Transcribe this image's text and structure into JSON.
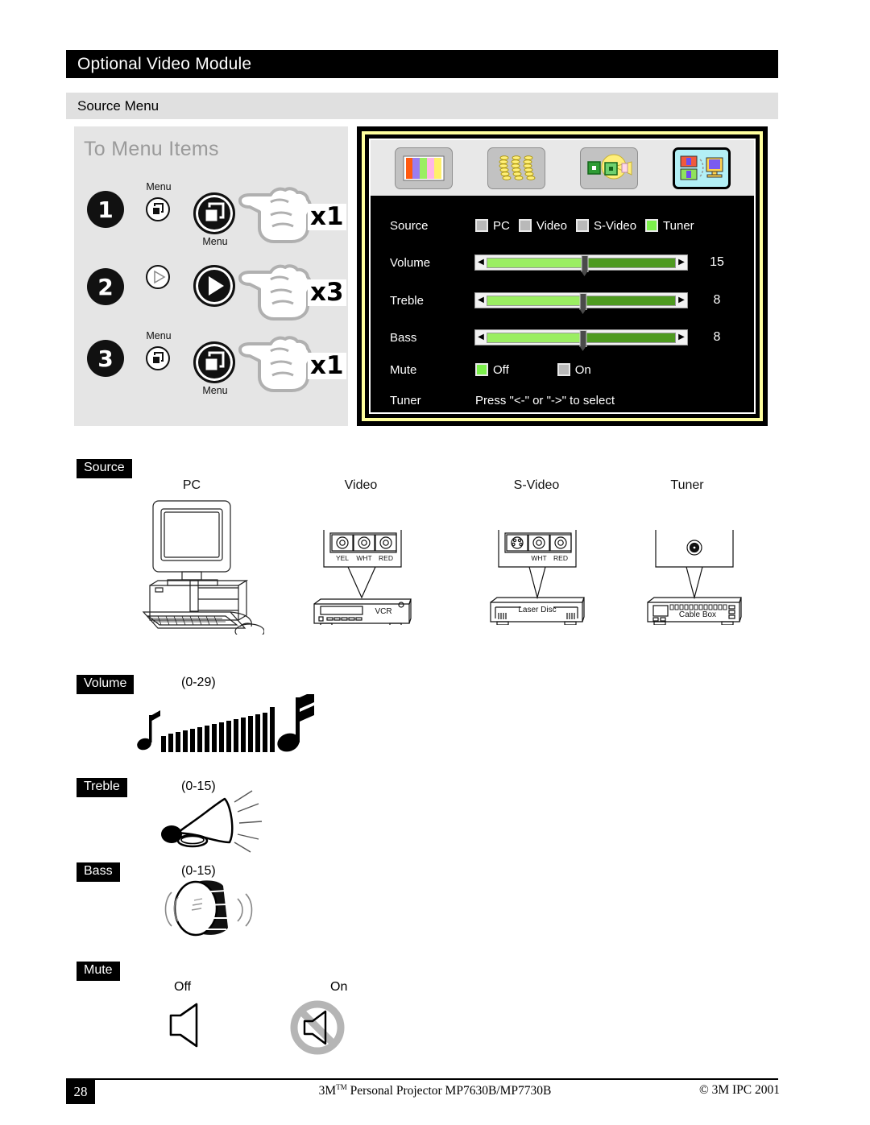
{
  "header": {
    "title": "Optional Video Module",
    "section": "Source Menu"
  },
  "steps_panel": {
    "title": "To Menu Items",
    "steps": [
      {
        "number": "1",
        "small_label": "Menu",
        "big_label": "Menu",
        "small_icon": "menu-icon",
        "big_icon": "menu-icon",
        "times": "x1"
      },
      {
        "number": "2",
        "small_label": "",
        "big_label": "",
        "small_icon": "play-right-arrow-icon",
        "big_icon": "play-right-arrow-icon",
        "times": "x3"
      },
      {
        "number": "3",
        "small_label": "Menu",
        "big_label": "Menu",
        "small_icon": "menu-icon",
        "big_icon": "menu-icon",
        "times": "x1"
      }
    ]
  },
  "osd": {
    "toolbar": [
      {
        "name": "color-bars-icon",
        "selected": false
      },
      {
        "name": "keystone-icon",
        "selected": false
      },
      {
        "name": "image-adjust-icon",
        "selected": false
      },
      {
        "name": "source-video-icon",
        "selected": true
      }
    ],
    "rows": {
      "source": {
        "label": "Source",
        "options": [
          {
            "label": "PC",
            "selected": false
          },
          {
            "label": "Video",
            "selected": false
          },
          {
            "label": "S-Video",
            "selected": false
          },
          {
            "label": "Tuner",
            "selected": true
          }
        ]
      },
      "volume": {
        "label": "Volume",
        "value": "15",
        "percent": 52
      },
      "treble": {
        "label": "Treble",
        "value": "8",
        "percent": 51
      },
      "bass": {
        "label": "Bass",
        "value": "8",
        "percent": 51
      },
      "mute": {
        "label": "Mute",
        "options": [
          {
            "label": "Off",
            "selected": true
          },
          {
            "label": "On",
            "selected": false
          }
        ]
      },
      "tuner": {
        "label": "Tuner",
        "hint": "Press \"<-\" or \"->\" to select"
      }
    }
  },
  "source_section": {
    "tag": "Source",
    "items": [
      {
        "heading": "PC",
        "device": "",
        "device_icon": "desktop-computer-icon",
        "jacks": []
      },
      {
        "heading": "Video",
        "device": "VCR",
        "device_icon": "vcr-icon",
        "jacks": [
          "YEL",
          "WHT",
          "RED"
        ]
      },
      {
        "heading": "S-Video",
        "device": "Laser Disc",
        "device_icon": "laser-disc-icon",
        "jacks": [
          "WHT",
          "RED"
        ]
      },
      {
        "heading": "Tuner",
        "device": "Cable Box",
        "device_icon": "cable-box-icon",
        "jacks": []
      }
    ]
  },
  "volume_section": {
    "tag": "Volume",
    "range": "(0-29)",
    "icon": "volume-bars-music-notes-icon"
  },
  "treble_section": {
    "tag": "Treble",
    "range": "(0-15)",
    "icon": "horn-icon"
  },
  "bass_section": {
    "tag": "Bass",
    "range": "(0-15)",
    "icon": "drum-icon"
  },
  "mute_section": {
    "tag": "Mute",
    "options": [
      {
        "label": "Off",
        "icon": "speaker-icon"
      },
      {
        "label": "On",
        "icon": "speaker-muted-icon"
      }
    ]
  },
  "footer": {
    "page": "28",
    "center_prefix": "3M",
    "center_tm": "TM",
    "center_suffix": " Personal Projector MP7630B/MP7730B",
    "right": "© 3M IPC 2001"
  },
  "colors": {
    "accent_green": "#7cf04c",
    "slider_fill": "#9bee62",
    "slider_track": "#4e9a20",
    "osd_border": "#ffff9e",
    "panel_gray": "#e5e5e5"
  }
}
